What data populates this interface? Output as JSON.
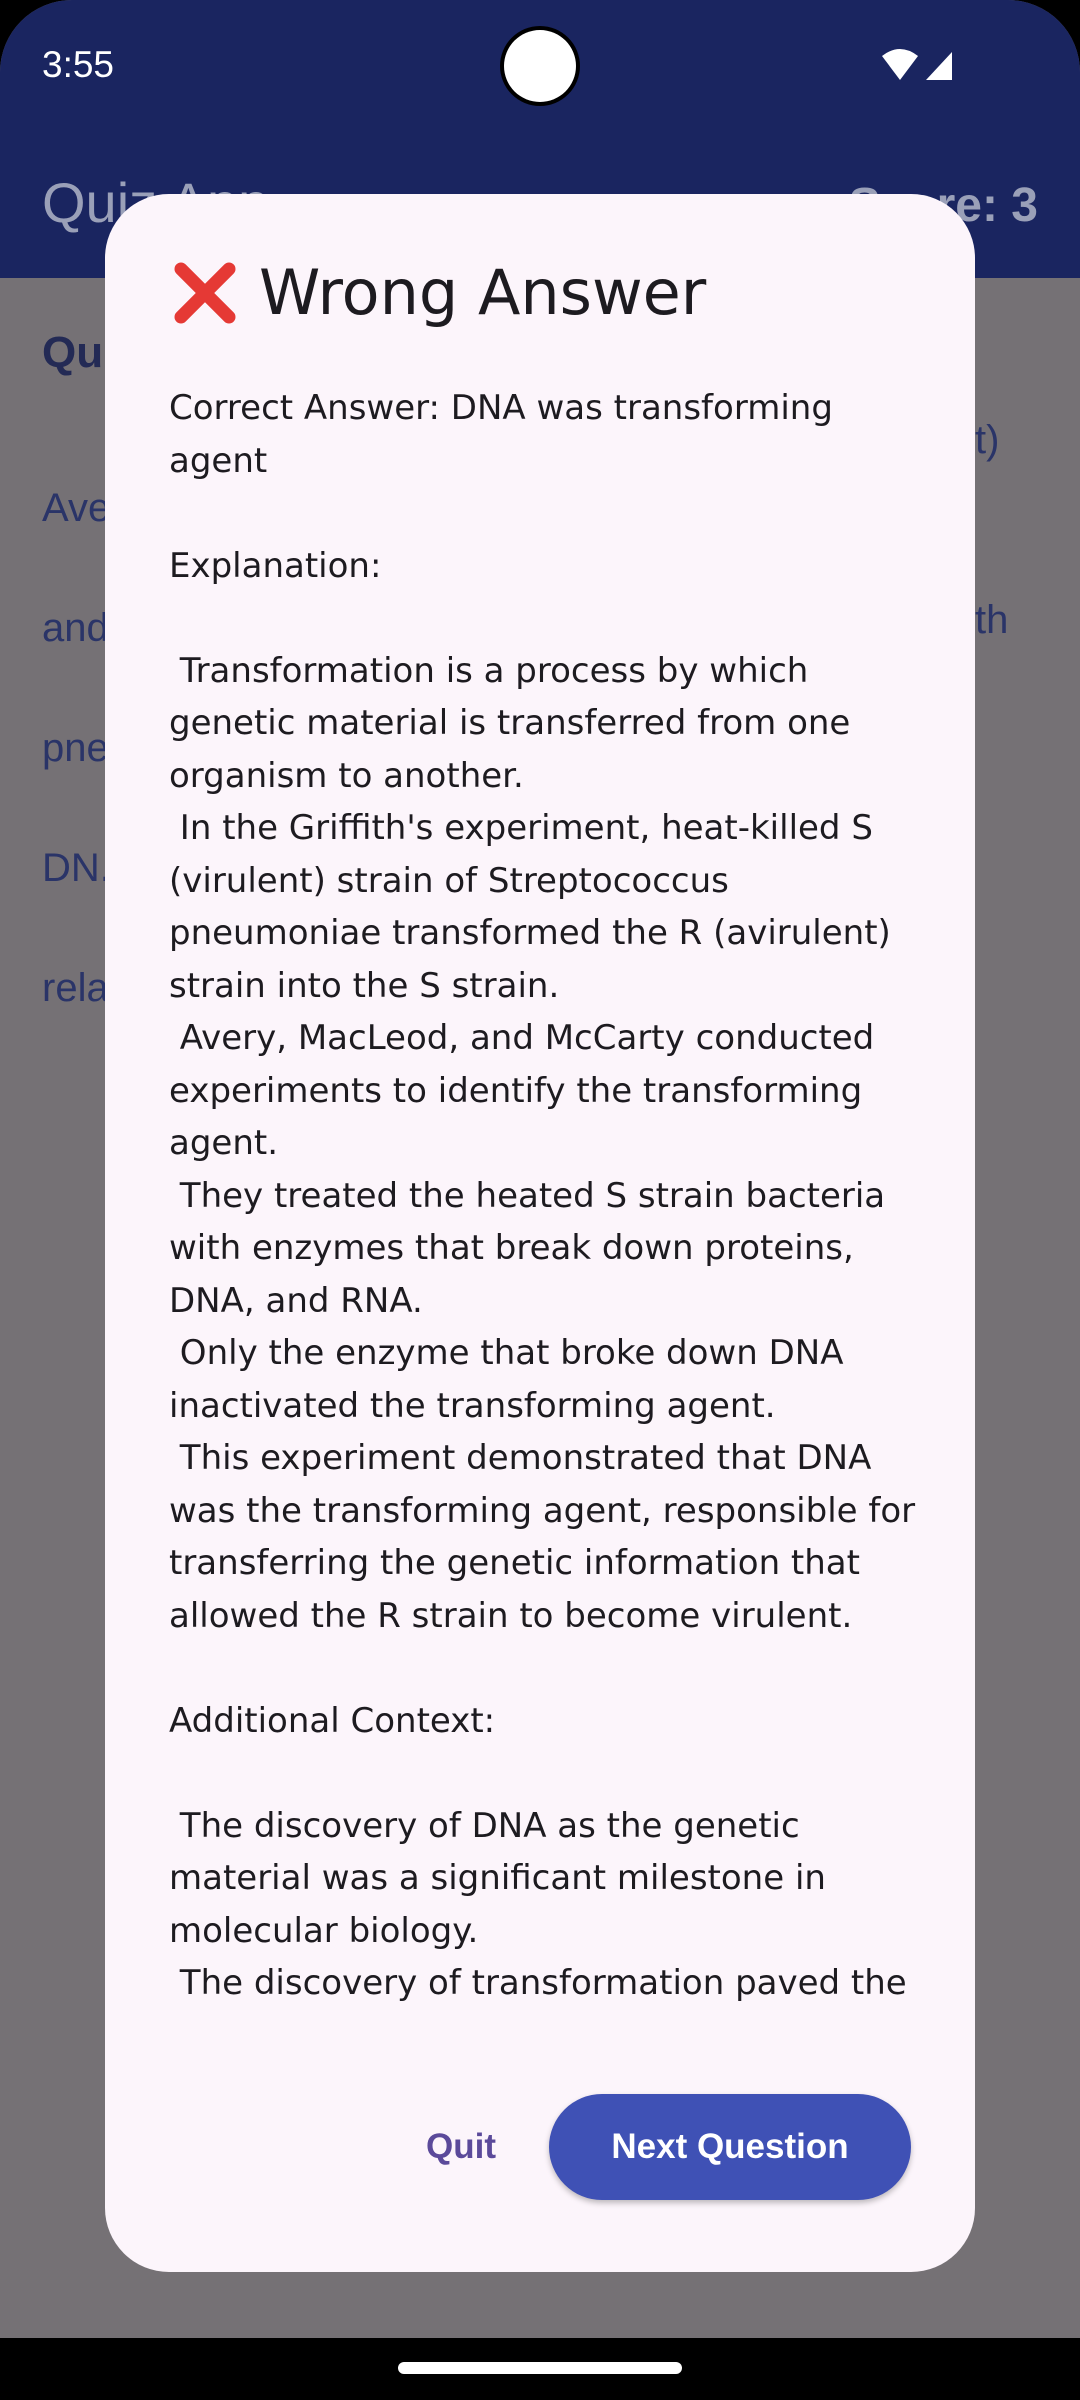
{
  "status_bar": {
    "time": "3:55"
  },
  "app_bar": {
    "title": "Quiz App",
    "score": "Score: 3"
  },
  "background": {
    "heading": "Qu",
    "text_lines": [
      "Ave",
      "and",
      "pne",
      "DN.",
      "rela"
    ],
    "suffix_1": "t)",
    "suffix_2": "th"
  },
  "dialog": {
    "icon": "cross-mark-icon",
    "title": "Wrong Answer",
    "body_lines": [
      "Correct Answer: DNA was transforming",
      "agent",
      "",
      "Explanation:",
      "",
      " Transformation is a process by which",
      "genetic material is transferred from one",
      "organism to another.",
      " In the Griffith's experiment, heat-killed S",
      "(virulent) strain of Streptococcus",
      "pneumoniae transformed the R (avirulent)",
      "strain into the S strain.",
      " Avery, MacLeod, and McCarty conducted",
      "experiments to identify the transforming",
      "agent.",
      " They treated the heated S strain bacteria",
      "with enzymes that break down proteins,",
      "DNA, and RNA.",
      " Only the enzyme that broke down DNA",
      "inactivated the transforming agent.",
      " This experiment demonstrated that DNA",
      "was the transforming agent, responsible for",
      "transferring the genetic information that",
      "allowed the R strain to become virulent.",
      "",
      "Additional Context:",
      "",
      " The discovery of DNA as the genetic",
      "material was a significant milestone in",
      "molecular biology.",
      " The discovery of transformation paved the"
    ],
    "quit_label": "Quit",
    "next_label": "Next Question"
  },
  "colors": {
    "app_bar": "#1a2560",
    "scrim": "#757175",
    "dialog_bg": "#fcf5fb",
    "primary_button": "#3f51b5",
    "text_button": "#5b4a9a",
    "error_icon": "#e53935"
  }
}
